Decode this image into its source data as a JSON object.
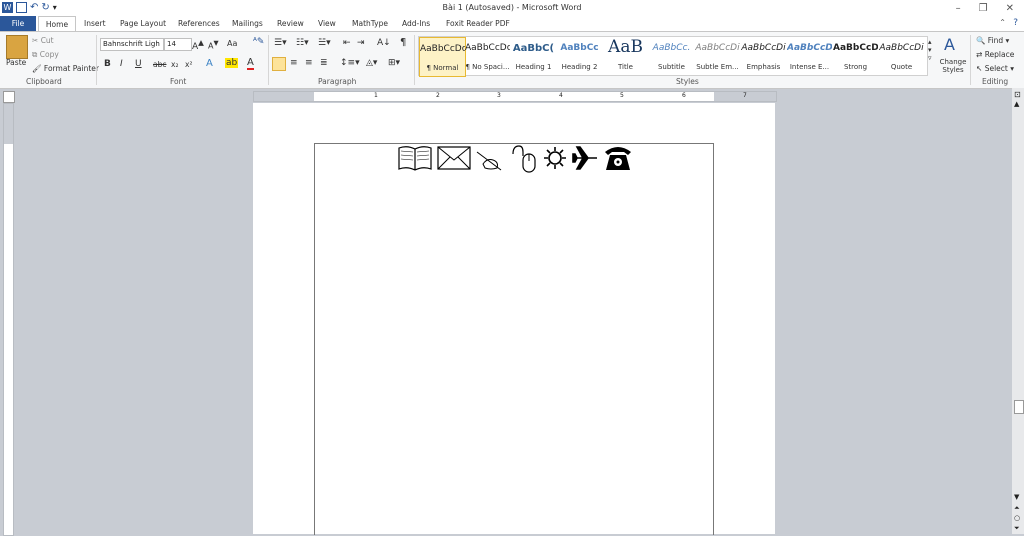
{
  "window": {
    "title": "Bài 1 (Autosaved)  -  Microsoft Word"
  },
  "tabs": [
    "File",
    "Home",
    "Insert",
    "Page Layout",
    "References",
    "Mailings",
    "Review",
    "View",
    "MathType",
    "Add-Ins",
    "Foxit Reader PDF"
  ],
  "clipboard": {
    "paste": "Paste",
    "cut": "Cut",
    "copy": "Copy",
    "format_painter": "Format Painter",
    "label": "Clipboard"
  },
  "font": {
    "name": "Bahnschrift Ligh",
    "size": "14",
    "label": "Font",
    "bold": "B",
    "italic": "I",
    "underline": "U",
    "strike": "abc",
    "sub": "x₂",
    "sup": "x²",
    "case": "Aa"
  },
  "paragraph": {
    "label": "Paragraph"
  },
  "styles": {
    "label": "Styles",
    "items": [
      {
        "sample": "AaBbCcDc",
        "name": "¶ Normal"
      },
      {
        "sample": "AaBbCcDc",
        "name": "¶ No Spaci..."
      },
      {
        "sample": "AaBbC(",
        "name": "Heading 1"
      },
      {
        "sample": "AaBbCc",
        "name": "Heading 2"
      },
      {
        "sample": "AaB",
        "name": "Title"
      },
      {
        "sample": "AaBbCc.",
        "name": "Subtitle"
      },
      {
        "sample": "AaBbCcDi",
        "name": "Subtle Em..."
      },
      {
        "sample": "AaBbCcDi",
        "name": "Emphasis"
      },
      {
        "sample": "AaBbCcDi",
        "name": "Intense E..."
      },
      {
        "sample": "AaBbCcDi",
        "name": "Strong"
      },
      {
        "sample": "AaBbCcDi",
        "name": "Quote"
      }
    ],
    "change_styles": "Change Styles"
  },
  "editing": {
    "label": "Editing",
    "find": "Find",
    "replace": "Replace",
    "select": "Select"
  },
  "ruler": {
    "marks": [
      "1",
      "2",
      "3",
      "4",
      "5",
      "6",
      "7"
    ]
  },
  "document": {
    "symbols": [
      "📖",
      "✉",
      "✍",
      "🖱",
      "☼",
      "✈",
      "☎"
    ]
  }
}
